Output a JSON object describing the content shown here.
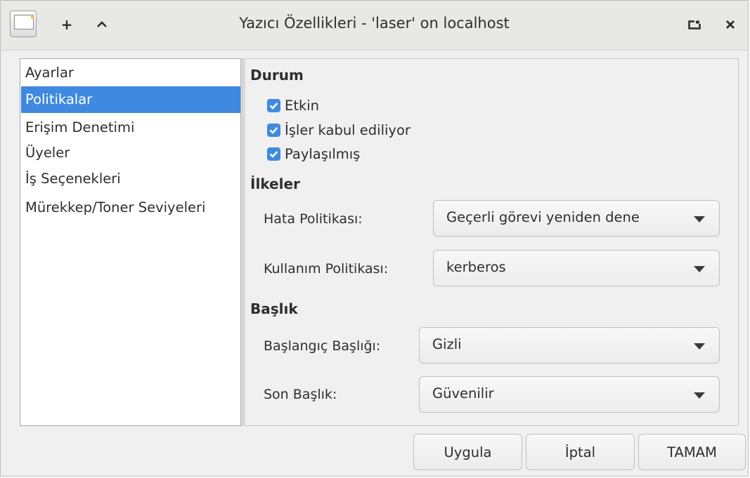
{
  "window": {
    "title": "Yazıcı Özellikleri - 'laser' on localhost",
    "add_symbol": "+",
    "up_symbol": "⌃",
    "maximize_symbol": "⧉",
    "close_symbol": "✕"
  },
  "sidebar": {
    "items": [
      {
        "label": "Ayarlar",
        "selected": false
      },
      {
        "label": "Politikalar",
        "selected": true
      },
      {
        "label": "Erişim Denetimi",
        "selected": false
      },
      {
        "label": "Üyeler",
        "selected": false
      },
      {
        "label": "İş Seçenekleri",
        "selected": false
      },
      {
        "label": "Mürekkep/Toner Seviyeleri",
        "selected": false
      }
    ]
  },
  "status_section": {
    "title": "Durum",
    "checkboxes": [
      {
        "label": "Etkin",
        "checked": true
      },
      {
        "label": "İşler kabul ediliyor",
        "checked": true
      },
      {
        "label": "Paylaşılmış",
        "checked": true
      }
    ]
  },
  "policies_section": {
    "title": "İlkeler",
    "error_policy_label": "Hata Politikası:",
    "error_policy_value": "Geçerli görevi yeniden dene",
    "usage_policy_label": "Kullanım Politikası:",
    "usage_policy_value": "kerberos"
  },
  "banner_section": {
    "title": "Başlık",
    "start_banner_label": "Başlangıç Başlığı:",
    "start_banner_value": "Gizli",
    "end_banner_label": "Son Başlık:",
    "end_banner_value": "Güvenilir"
  },
  "buttons": {
    "apply": "Uygula",
    "cancel": "İptal",
    "ok": "TAMAM"
  },
  "colors": {
    "accent": "#3f8ae0"
  }
}
